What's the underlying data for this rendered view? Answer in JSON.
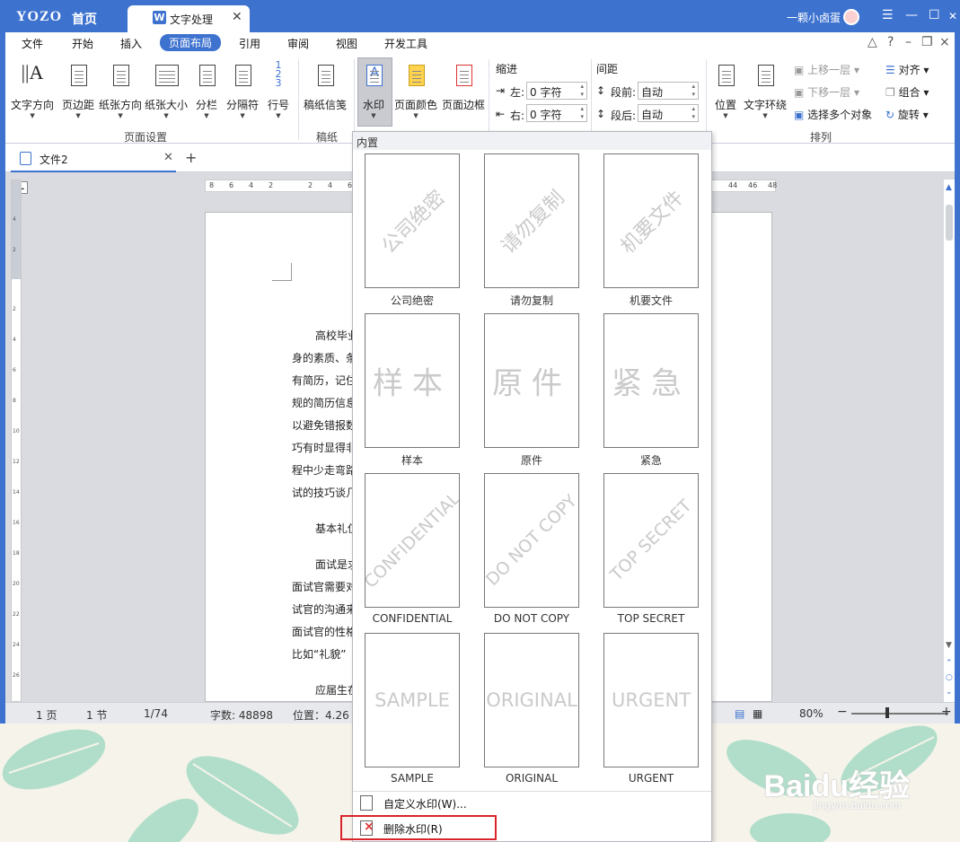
{
  "app": {
    "logo": "YOZO",
    "home": "首页",
    "tab_title": "文字处理",
    "tab_icon_letter": "W",
    "user": "一颗小卤蛋"
  },
  "window_controls": [
    "☰",
    "—",
    "☐",
    "✕"
  ],
  "menu": {
    "items": [
      "文件",
      "开始",
      "插入",
      "页面布局",
      "引用",
      "审阅",
      "视图",
      "开发工具"
    ],
    "active": "页面布局"
  },
  "ribbon": {
    "buttons": [
      "文字方向",
      "页边距",
      "纸张方向",
      "纸张大小",
      "分栏",
      "分隔符",
      "行号",
      "稿纸信笺",
      "水印",
      "页面颜色",
      "页面边框"
    ],
    "groups": [
      "页面设置",
      "稿纸",
      "排列"
    ],
    "indent": {
      "title": "缩进",
      "left_label": "左:",
      "left_value": "0 字符",
      "right_label": "右:",
      "right_value": "0 字符"
    },
    "spacing": {
      "title": "间距",
      "before_label": "段前:",
      "before_value": "自动",
      "after_label": "段后:",
      "after_value": "自动"
    },
    "arrange": {
      "position": "位置",
      "wrap": "文字环绕",
      "bring_forward": "上移一层",
      "send_backward": "下移一层",
      "select_multiple": "选择多个对象",
      "align": "对齐",
      "group": "组合",
      "rotate": "旋转"
    }
  },
  "doc_tab": {
    "name": "文件2"
  },
  "ruler": {
    "h_left": [
      "8",
      "6",
      "4",
      "2",
      "2",
      "4",
      "6"
    ],
    "h_right": [
      "44",
      "46",
      "48"
    ],
    "v": [
      "4",
      "2",
      "2",
      "4",
      "6",
      "8",
      "10",
      "12",
      "14",
      "16",
      "18",
      "20",
      "22",
      "24",
      "26",
      "28"
    ]
  },
  "page_lines": [
    "高校毕业",
    "身的素质、条",
    "有简历，记住",
    "规的简历信息",
    "以避免错报数",
    "巧有时显得非",
    "程中少走弯路",
    "试的技巧谈几",
    "基本礼仪",
    "面试是求",
    "面试官需要对",
    "试官的沟通来",
    "面试官的性格",
    "比如“礼貌”",
    "应届生在"
  ],
  "status": {
    "pages": "1 页",
    "section": "1 节",
    "page_of": "1/74",
    "words": "字数: 48898",
    "position": "位置：4.26",
    "zoom": "80%"
  },
  "watermark_menu": {
    "header": "内置",
    "items": [
      {
        "label": "公司绝密",
        "preview": "公司绝密"
      },
      {
        "label": "请勿复制",
        "preview": "请勿复制"
      },
      {
        "label": "机要文件",
        "preview": "机要文件"
      },
      {
        "label": "样本",
        "preview": "样本"
      },
      {
        "label": "原件",
        "preview": "原件"
      },
      {
        "label": "紧急",
        "preview": "紧急"
      },
      {
        "label": "CONFIDENTIAL",
        "preview": "CONFIDENTIAL"
      },
      {
        "label": "DO NOT COPY",
        "preview": "DO NOT COPY"
      },
      {
        "label": "TOP SECRET",
        "preview": "TOP SECRET"
      },
      {
        "label": "SAMPLE",
        "preview": "SAMPLE"
      },
      {
        "label": "ORIGINAL",
        "preview": "ORIGINAL"
      },
      {
        "label": "URGENT",
        "preview": "URGENT"
      }
    ],
    "custom": "自定义水印(W)...",
    "remove": "删除水印(R)"
  },
  "brand": {
    "baidu": "Baidu经验",
    "site": "jingyan.baidu.com"
  },
  "colors": {
    "accent": "#3d72cf",
    "highlight": "#d9252a"
  }
}
